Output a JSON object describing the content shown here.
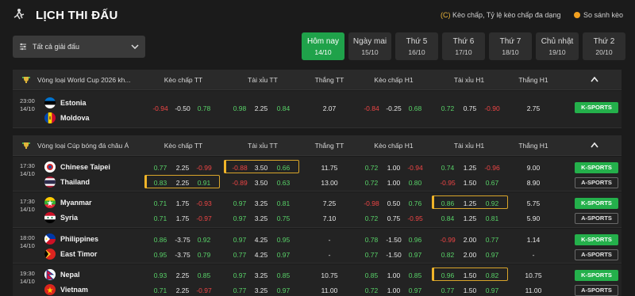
{
  "header": {
    "title": "LỊCH THI ĐẤU"
  },
  "legend": {
    "mark": "(C)",
    "odds_text": "Kèo chấp, Tỷ lệ kèo chấp đa dạng",
    "compare_text": "So sánh kèo"
  },
  "filter": {
    "label": "Tất cả giải đấu"
  },
  "days": [
    {
      "name": "Hôm nay",
      "date": "14/10",
      "active": true
    },
    {
      "name": "Ngày mai",
      "date": "15/10"
    },
    {
      "name": "Thứ 5",
      "date": "16/10"
    },
    {
      "name": "Thứ 6",
      "date": "17/10"
    },
    {
      "name": "Thứ 7",
      "date": "18/10"
    },
    {
      "name": "Chủ nhật",
      "date": "19/10"
    },
    {
      "name": "Thứ 2",
      "date": "20/10"
    }
  ],
  "columns": [
    "Kèo chấp TT",
    "Tài xỉu TT",
    "Thắng TT",
    "Kèo chấp H1",
    "Tài xỉu H1",
    "Thắng H1"
  ],
  "colors": {
    "accent": "#1fa24a",
    "up": "#58d268",
    "down": "#ee4545",
    "highlight": "#f0b429"
  },
  "leagues": [
    {
      "name": "Vòng loại World Cup 2026 kh...",
      "matches": [
        {
          "time": "23:00",
          "date": "14/10",
          "home": "Estonia",
          "away": "Moldova",
          "home_flag": "estonia-flag",
          "away_flag": "moldova-flag",
          "single": true,
          "row1": [
            "-0.94",
            "-0.50",
            "0.78",
            "0.98",
            "2.25",
            "0.84",
            "2.07",
            "-0.84",
            "-0.25",
            "0.68",
            "0.72",
            "0.75",
            "-0.90",
            "2.75"
          ],
          "btn1": "K-SPORTS"
        }
      ]
    },
    {
      "name": "Vòng loại Cúp bóng đá châu Á",
      "matches": [
        {
          "time": "17:30",
          "date": "14/10",
          "home": "Chinese Taipei",
          "away": "Thailand",
          "home_flag": "chinese-taipei-flag",
          "away_flag": "thailand-flag",
          "row1": [
            "0.77",
            "2.25",
            "-0.99",
            "-0.88",
            "3.50",
            "0.66",
            "11.75",
            "0.72",
            "1.00",
            "-0.94",
            "0.74",
            "1.25",
            "-0.96",
            "9.00"
          ],
          "row2": [
            "0.83",
            "2.25",
            "0.91",
            "-0.89",
            "3.50",
            "0.63",
            "13.00",
            "0.72",
            "1.00",
            "0.80",
            "-0.95",
            "1.50",
            "0.67",
            "8.90"
          ],
          "btn1": "K-SPORTS",
          "btn2": "A-SPORTS"
        },
        {
          "time": "17:30",
          "date": "14/10",
          "home": "Myanmar",
          "away": "Syria",
          "home_flag": "myanmar-flag",
          "away_flag": "syria-flag",
          "row1": [
            "0.71",
            "1.75",
            "-0.93",
            "0.97",
            "3.25",
            "0.81",
            "7.25",
            "-0.98",
            "0.50",
            "0.76",
            "0.86",
            "1.25",
            "0.92",
            "5.75"
          ],
          "row2": [
            "0.71",
            "1.75",
            "-0.97",
            "0.97",
            "3.25",
            "0.75",
            "7.10",
            "0.72",
            "0.75",
            "-0.95",
            "0.84",
            "1.25",
            "0.81",
            "5.90"
          ],
          "btn1": "K-SPORTS",
          "btn2": "A-SPORTS"
        },
        {
          "time": "18:00",
          "date": "14/10",
          "home": "Philippines",
          "away": "East Timor",
          "home_flag": "philippines-flag",
          "away_flag": "east-timor-flag",
          "row1": [
            "0.86",
            "-3.75",
            "0.92",
            "0.97",
            "4.25",
            "0.95",
            "-",
            "0.78",
            "-1.50",
            "0.96",
            "-0.99",
            "2.00",
            "0.77",
            "1.14"
          ],
          "row2": [
            "0.95",
            "-3.75",
            "0.79",
            "0.77",
            "4.25",
            "0.97",
            "-",
            "0.77",
            "-1.50",
            "0.97",
            "0.82",
            "2.00",
            "0.97",
            "-"
          ],
          "btn1": "K-SPORTS",
          "btn2": "A-SPORTS"
        },
        {
          "time": "19:30",
          "date": "14/10",
          "home": "Nepal",
          "away": "Vietnam",
          "home_flag": "nepal-flag",
          "away_flag": "vietnam-flag",
          "row1": [
            "0.93",
            "2.25",
            "0.85",
            "0.97",
            "3.25",
            "0.85",
            "10.75",
            "0.85",
            "1.00",
            "0.85",
            "0.96",
            "1.50",
            "0.82",
            "10.75"
          ],
          "row2": [
            "0.71",
            "2.25",
            "-0.97",
            "0.77",
            "3.25",
            "0.97",
            "11.00",
            "0.72",
            "1.00",
            "0.97",
            "0.77",
            "1.50",
            "0.97",
            "11.00"
          ],
          "btn1": "K-SPORTS",
          "btn2": "A-SPORTS"
        }
      ]
    }
  ]
}
